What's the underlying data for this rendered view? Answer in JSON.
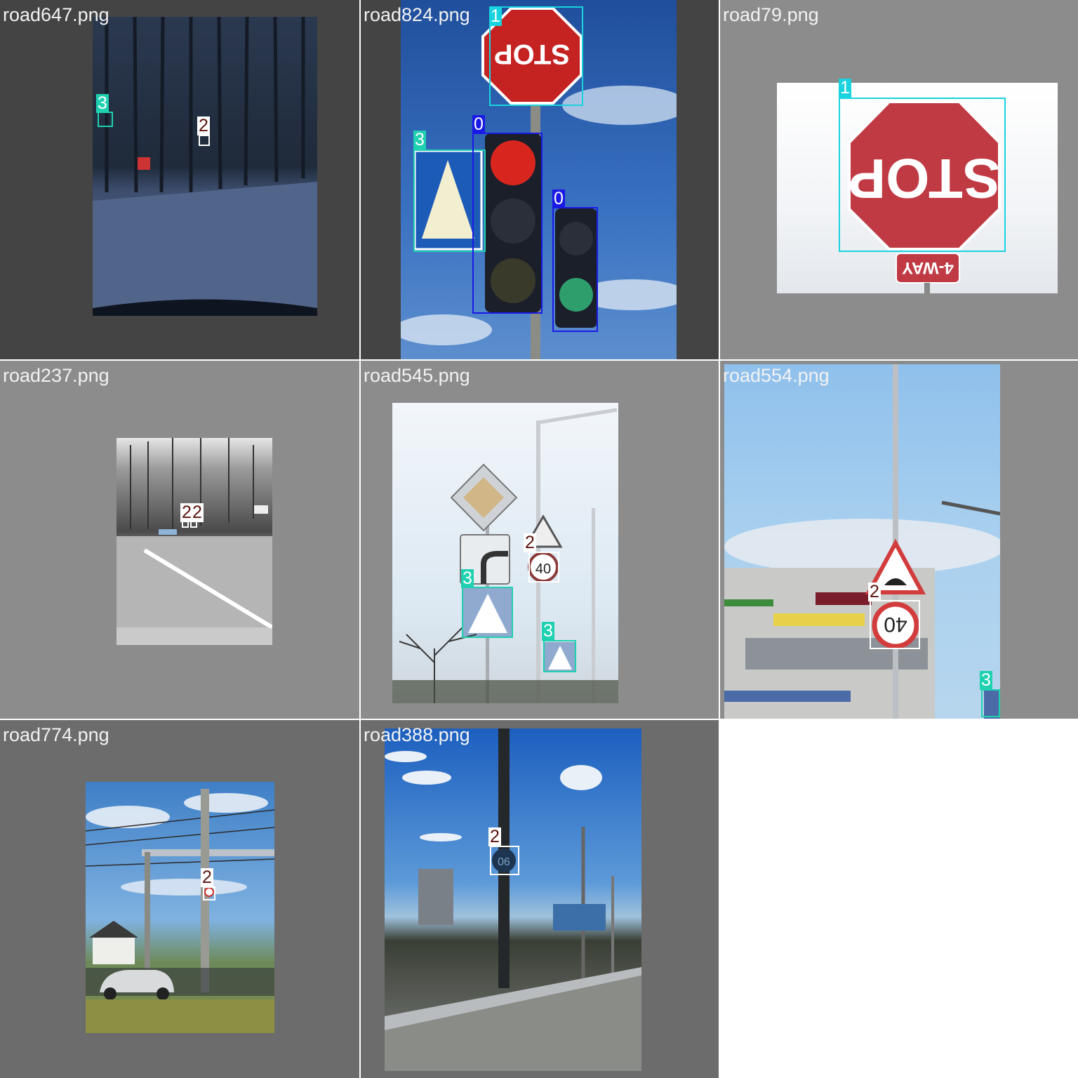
{
  "tiles": [
    {
      "filename": "road647.png"
    },
    {
      "filename": "road824.png"
    },
    {
      "filename": "road79.png"
    },
    {
      "filename": "road237.png"
    },
    {
      "filename": "road545.png"
    },
    {
      "filename": "road554.png"
    },
    {
      "filename": "road774.png"
    },
    {
      "filename": "road388.png"
    }
  ],
  "class_labels": {
    "c0": "0",
    "c1": "1",
    "c2": "2",
    "c3": "3"
  },
  "sign_text": {
    "stop": "STOP",
    "four_way": "4-WAY",
    "speed40": "40",
    "speed50": "50",
    "speed90": "90"
  },
  "colors": {
    "class0": "#1a1ae6",
    "class1": "#19d3df",
    "class2": "#ffffff",
    "class3": "#1fd1b0"
  }
}
